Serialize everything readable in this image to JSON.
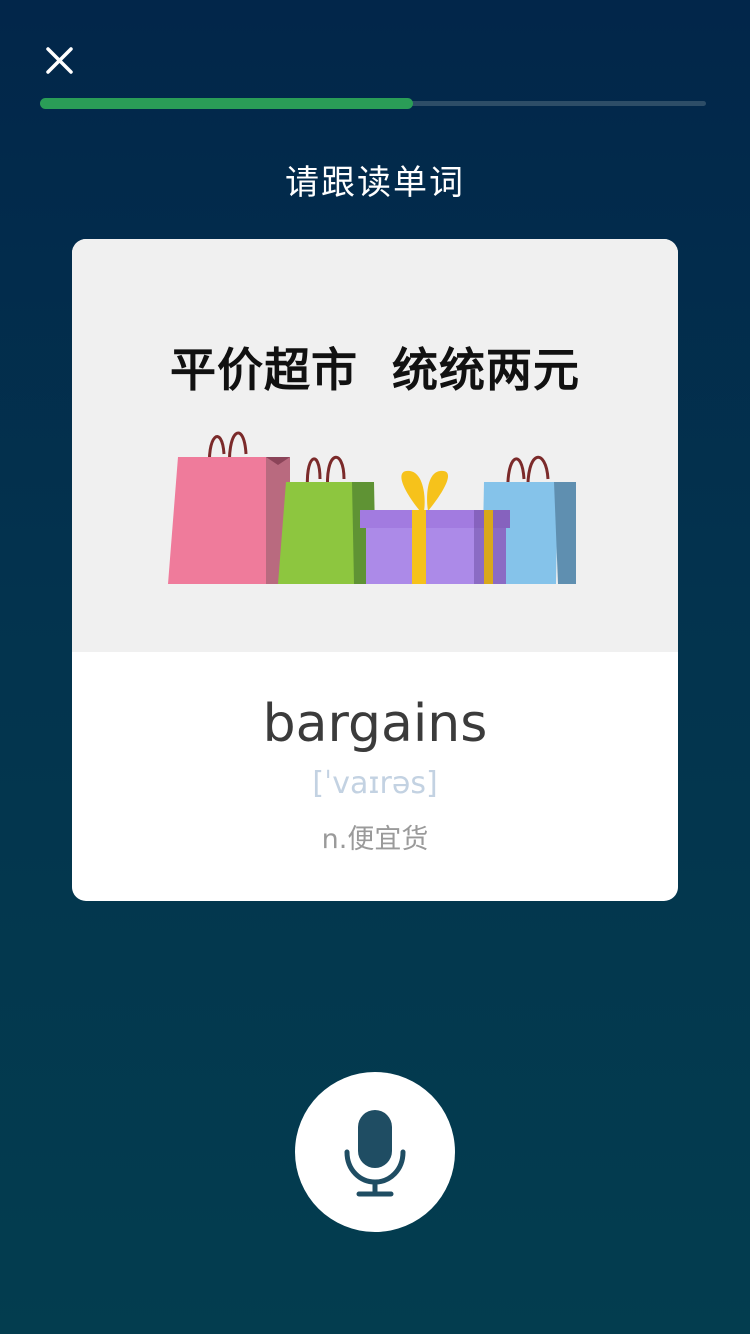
{
  "header": {
    "close_icon": "close-icon",
    "progress_percent": 56
  },
  "instruction": "请跟读单词",
  "card": {
    "image_caption": "平价超市  统统两元",
    "illustration": "shopping-bags-and-gift-illustration",
    "word": "bargains",
    "phonetic": "[ˈvaɪrəs]",
    "meaning": "n.便宜货"
  },
  "footer": {
    "mic_icon": "microphone-icon"
  },
  "colors": {
    "progress": "#2a9d57",
    "track": "#2d4d67",
    "mic_icon": "#1f4d63",
    "phonetic": "#c3d2e2"
  }
}
